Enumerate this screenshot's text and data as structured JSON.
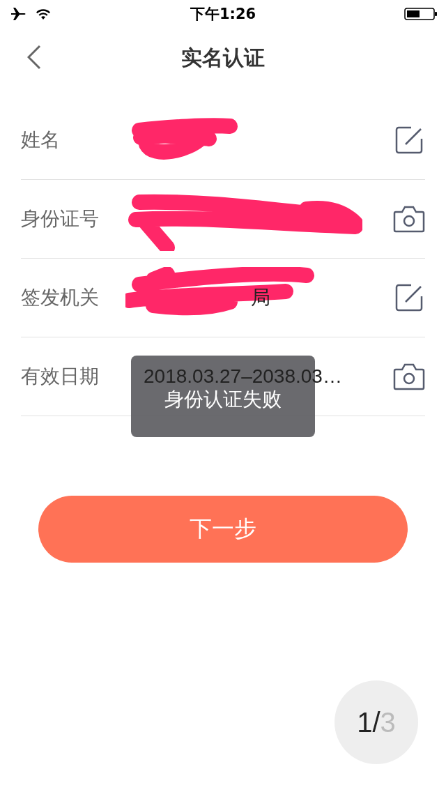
{
  "status_bar": {
    "time": "下午1:26",
    "airplane_mode": true
  },
  "nav": {
    "title": "实名认证"
  },
  "fields": [
    {
      "kind": "edit",
      "label": "姓名",
      "redacted": true
    },
    {
      "kind": "camera",
      "label": "身份证号",
      "redacted": true
    },
    {
      "kind": "edit",
      "label": "签发机关",
      "value": "局",
      "redacted": true
    },
    {
      "kind": "camera",
      "label": "有效日期",
      "value": "2018.03.27–2038.03…",
      "redacted": false
    }
  ],
  "toast": {
    "text": "身份认证失败"
  },
  "next_button": {
    "label": "下一步"
  },
  "page_indicator": {
    "current": "1",
    "separator": "/",
    "total": "3"
  }
}
